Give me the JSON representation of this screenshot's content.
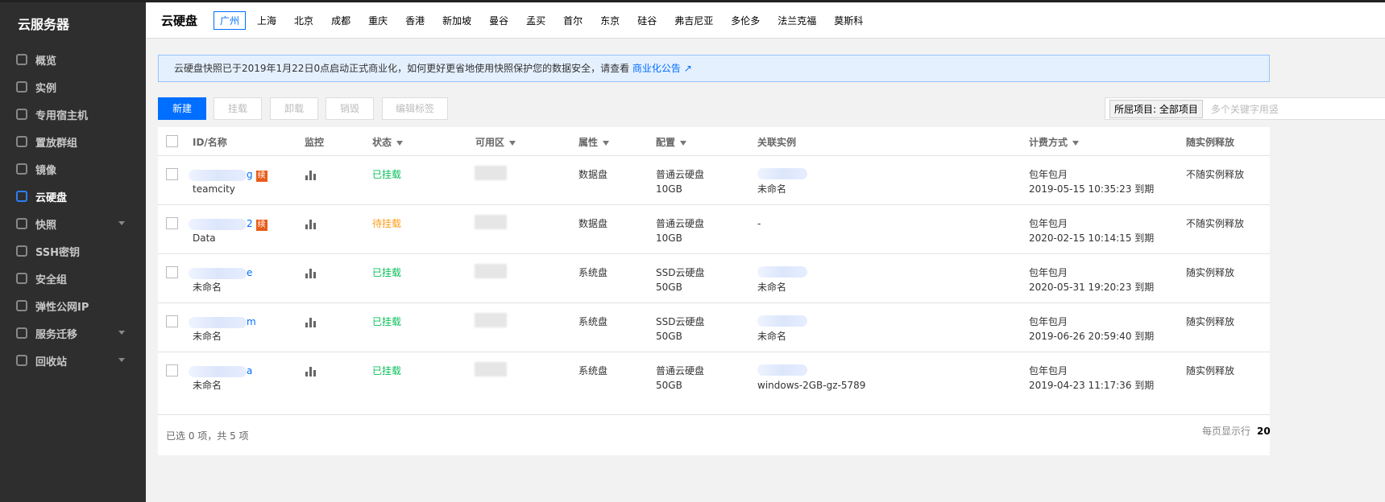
{
  "sidebar": {
    "title": "云服务器",
    "items": [
      {
        "label": "概览",
        "icon": "dashboard-icon"
      },
      {
        "label": "实例",
        "icon": "instance-icon"
      },
      {
        "label": "专用宿主机",
        "icon": "host-icon"
      },
      {
        "label": "置放群组",
        "icon": "placement-group-icon"
      },
      {
        "label": "镜像",
        "icon": "image-icon"
      },
      {
        "label": "云硬盘",
        "icon": "disk-icon",
        "active": true
      },
      {
        "label": "快照",
        "icon": "snapshot-icon",
        "expandable": true
      },
      {
        "label": "SSH密钥",
        "icon": "key-icon"
      },
      {
        "label": "安全组",
        "icon": "shield-icon"
      },
      {
        "label": "弹性公网IP",
        "icon": "ip-icon"
      },
      {
        "label": "服务迁移",
        "icon": "migrate-icon",
        "expandable": true
      },
      {
        "label": "回收站",
        "icon": "trash-icon",
        "expandable": true
      }
    ]
  },
  "header": {
    "title": "云硬盘",
    "regions": [
      "广州",
      "上海",
      "北京",
      "成都",
      "重庆",
      "香港",
      "新加坡",
      "曼谷",
      "孟买",
      "首尔",
      "东京",
      "硅谷",
      "弗吉尼亚",
      "多伦多",
      "法兰克福",
      "莫斯科"
    ],
    "active_region": "广州"
  },
  "notice": {
    "text": "云硬盘快照已于2019年1月22日0点启动正式商业化，如何更好更省地使用快照保护您的数据安全，请查看",
    "link": "商业化公告"
  },
  "toolbar": {
    "new": "新建",
    "attach": "挂载",
    "detach": "卸载",
    "destroy": "销毁",
    "edit_tags": "编辑标签",
    "project": "所屈项目: 全部项目",
    "search_placeholder": "多个关键字用竖"
  },
  "table": {
    "headers": {
      "id": "ID/名称",
      "monitor": "监控",
      "status": "状态",
      "zone": "可用区",
      "attr": "属性",
      "config": "配置",
      "instance": "关联实例",
      "billing": "计费方式",
      "release": "随实例释放"
    },
    "rows": [
      {
        "id_suffix": "g",
        "renew": "续",
        "name": "teamcity",
        "status": "已挂载",
        "status_color": "#0abf5b",
        "attr": "数据盘",
        "type": "普通云硬盘",
        "size": "10GB",
        "instance": "未命名",
        "billing": "包年包月",
        "expire": "2019-05-15 10:35:23 到期",
        "release": "不随实例释放"
      },
      {
        "id_suffix": "2",
        "renew": "续",
        "name": "Data",
        "status": "待挂载",
        "status_color": "#ff9c19",
        "attr": "数据盘",
        "type": "普通云硬盘",
        "size": "10GB",
        "instance": "-",
        "billing": "包年包月",
        "expire": "2020-02-15 10:14:15 到期",
        "release": "不随实例释放"
      },
      {
        "id_suffix": "e",
        "name": "未命名",
        "status": "已挂载",
        "status_color": "#0abf5b",
        "attr": "系统盘",
        "type": "SSD云硬盘",
        "size": "50GB",
        "instance": "未命名",
        "billing": "包年包月",
        "expire": "2020-05-31 19:20:23 到期",
        "release": "随实例释放"
      },
      {
        "id_suffix": "m",
        "name": "未命名",
        "status": "已挂载",
        "status_color": "#0abf5b",
        "attr": "系统盘",
        "type": "SSD云硬盘",
        "size": "50GB",
        "instance": "未命名",
        "billing": "包年包月",
        "expire": "2019-06-26 20:59:40 到期",
        "release": "随实例释放"
      },
      {
        "id_suffix": "a",
        "name": "未命名",
        "status": "已挂载",
        "status_color": "#0abf5b",
        "attr": "系统盘",
        "type": "普通云硬盘",
        "size": "50GB",
        "instance": "windows-2GB-gz-5789",
        "billing": "包年包月",
        "expire": "2019-04-23 11:17:36 到期",
        "release": "随实例释放"
      }
    ]
  },
  "footer": {
    "summary": "已选 0 项，共 5 项",
    "page_size_label": "每页显示行",
    "page_size": "20"
  }
}
